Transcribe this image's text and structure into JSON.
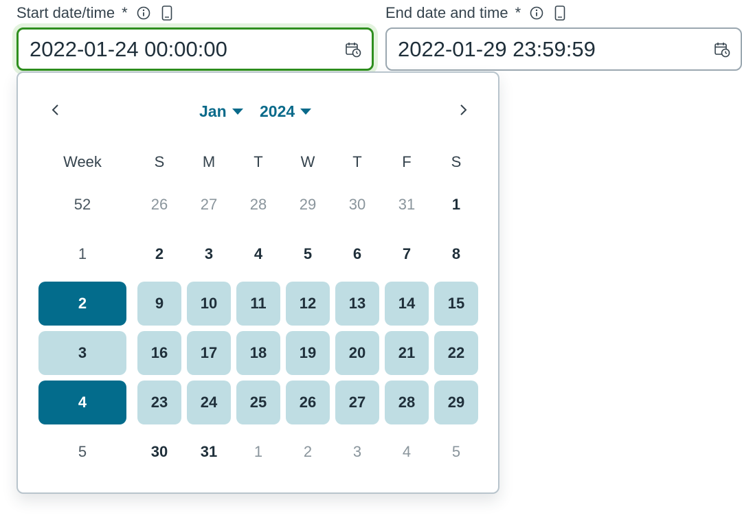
{
  "start_field": {
    "label": "Start date/time",
    "required_marker": "*",
    "value": "2022-01-24 00:00:00"
  },
  "end_field": {
    "label": "End date and time",
    "required_marker": "*",
    "value": "2022-01-29 23:59:59"
  },
  "calendar": {
    "month": "Jan",
    "year": "2024",
    "week_header": "Week",
    "weekdays": [
      "S",
      "M",
      "T",
      "W",
      "T",
      "F",
      "S"
    ],
    "weeks": [
      {
        "week": "52",
        "state": "normal",
        "days": [
          {
            "d": "26",
            "month": "other"
          },
          {
            "d": "27",
            "month": "other"
          },
          {
            "d": "28",
            "month": "other"
          },
          {
            "d": "29",
            "month": "other"
          },
          {
            "d": "30",
            "month": "other"
          },
          {
            "d": "31",
            "month": "other"
          },
          {
            "d": "1",
            "month": "current"
          }
        ]
      },
      {
        "week": "1",
        "state": "normal",
        "days": [
          {
            "d": "2",
            "month": "current"
          },
          {
            "d": "3",
            "month": "current"
          },
          {
            "d": "4",
            "month": "current"
          },
          {
            "d": "5",
            "month": "current"
          },
          {
            "d": "6",
            "month": "current"
          },
          {
            "d": "7",
            "month": "current"
          },
          {
            "d": "8",
            "month": "current"
          }
        ]
      },
      {
        "week": "2",
        "state": "selected",
        "days": [
          {
            "d": "9",
            "month": "current",
            "in_range": true
          },
          {
            "d": "10",
            "month": "current",
            "in_range": true
          },
          {
            "d": "11",
            "month": "current",
            "in_range": true
          },
          {
            "d": "12",
            "month": "current",
            "in_range": true
          },
          {
            "d": "13",
            "month": "current",
            "in_range": true
          },
          {
            "d": "14",
            "month": "current",
            "in_range": true
          },
          {
            "d": "15",
            "month": "current",
            "in_range": true
          }
        ]
      },
      {
        "week": "3",
        "state": "in-range",
        "days": [
          {
            "d": "16",
            "month": "current",
            "in_range": true
          },
          {
            "d": "17",
            "month": "current",
            "in_range": true
          },
          {
            "d": "18",
            "month": "current",
            "in_range": true
          },
          {
            "d": "19",
            "month": "current",
            "in_range": true
          },
          {
            "d": "20",
            "month": "current",
            "in_range": true
          },
          {
            "d": "21",
            "month": "current",
            "in_range": true
          },
          {
            "d": "22",
            "month": "current",
            "in_range": true
          }
        ]
      },
      {
        "week": "4",
        "state": "selected",
        "days": [
          {
            "d": "23",
            "month": "current",
            "in_range": true
          },
          {
            "d": "24",
            "month": "current",
            "in_range": true
          },
          {
            "d": "25",
            "month": "current",
            "in_range": true
          },
          {
            "d": "26",
            "month": "current",
            "in_range": true
          },
          {
            "d": "27",
            "month": "current",
            "in_range": true
          },
          {
            "d": "28",
            "month": "current",
            "in_range": true
          },
          {
            "d": "29",
            "month": "current",
            "in_range": true
          }
        ]
      },
      {
        "week": "5",
        "state": "normal",
        "days": [
          {
            "d": "30",
            "month": "current"
          },
          {
            "d": "31",
            "month": "current"
          },
          {
            "d": "1",
            "month": "other"
          },
          {
            "d": "2",
            "month": "other"
          },
          {
            "d": "3",
            "month": "other"
          },
          {
            "d": "4",
            "month": "other"
          },
          {
            "d": "5",
            "month": "other"
          }
        ]
      }
    ]
  },
  "colors": {
    "accent": "#036c8c",
    "range_fill": "#bfdde3",
    "focus_border": "#2e8f1e",
    "focus_ring": "#e3f3de"
  },
  "icons": {
    "info": "info-circle-icon",
    "device": "mobile-device-icon",
    "calendar": "calendar-clock-icon",
    "prev": "chevron-left-icon",
    "next": "chevron-right-icon",
    "dropdown": "caret-down-icon"
  }
}
